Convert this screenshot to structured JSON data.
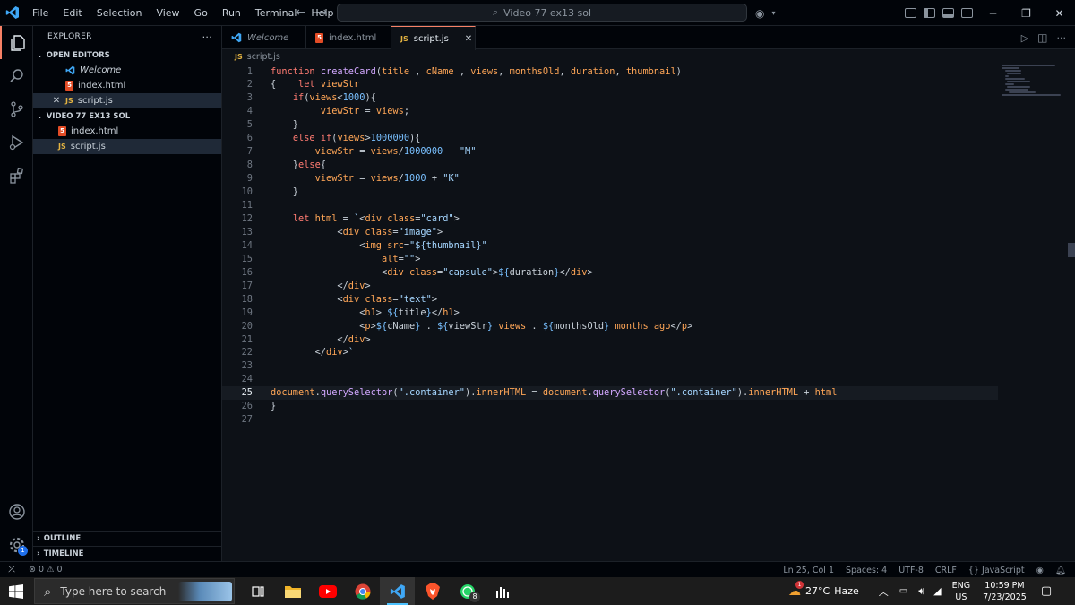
{
  "menu": [
    "File",
    "Edit",
    "Selection",
    "View",
    "Go",
    "Run",
    "Terminal",
    "Help"
  ],
  "command_center": "Video 77 ex13 sol",
  "sidebar": {
    "title": "EXPLORER",
    "open_editors_label": "OPEN EDITORS",
    "open_editors": [
      {
        "name": "Welcome",
        "type": "vscode",
        "italic": true
      },
      {
        "name": "index.html",
        "type": "html"
      },
      {
        "name": "script.js",
        "type": "js",
        "selected": true
      }
    ],
    "folder_label": "VIDEO 77 EX13 SOL",
    "files": [
      {
        "name": "index.html",
        "type": "html"
      },
      {
        "name": "script.js",
        "type": "js",
        "selected": true
      }
    ],
    "outline_label": "OUTLINE",
    "timeline_label": "TIMELINE"
  },
  "tabs": [
    {
      "name": "Welcome",
      "type": "vscode"
    },
    {
      "name": "index.html",
      "type": "html"
    },
    {
      "name": "script.js",
      "type": "js",
      "active": true
    }
  ],
  "breadcrumb": {
    "file": "script.js",
    "badge": "JS"
  },
  "code": {
    "current_line": 25,
    "lines": [
      "function createCard(title , cName , views, monthsOld, duration, thumbnail)",
      "{    let viewStr",
      "    if(views<1000){",
      "         viewStr = views;",
      "    }",
      "    else if(views>1000000){",
      "        viewStr = views/1000000 + \"M\"",
      "    }else{",
      "        viewStr = views/1000 + \"K\"",
      "    }",
      "",
      "    let html = `<div class=\"card\">",
      "            <div class=\"image\">",
      "                <img src=\"${thumbnail}\"",
      "                    alt=\"\">",
      "                    <div class=\"capsule\">${duration}</div>",
      "            </div>",
      "            <div class=\"text\">",
      "                <h1> ${title}</h1>",
      "                <p>${cName} . ${viewStr} views . ${monthsOld} months ago</p>",
      "            </div>",
      "        </div>`",
      "",
      "",
      "document.querySelector(\".container\").innerHTML = document.querySelector(\".container\").innerHTML + html",
      "}",
      ""
    ]
  },
  "status": {
    "errors": "0",
    "warnings": "0",
    "position": "Ln 25, Col 1",
    "spaces": "Spaces: 4",
    "encoding": "UTF-8",
    "eol": "CRLF",
    "language": "JavaScript"
  },
  "taskbar": {
    "search_placeholder": "Type here to search",
    "weather_temp": "27°C",
    "weather_desc": "Haze",
    "weather_badge": "1",
    "whatsapp_badge": "8",
    "lang": "ENG",
    "region": "US",
    "time": "10:59 PM",
    "date": "7/23/2025"
  },
  "accounts_badge": "1"
}
